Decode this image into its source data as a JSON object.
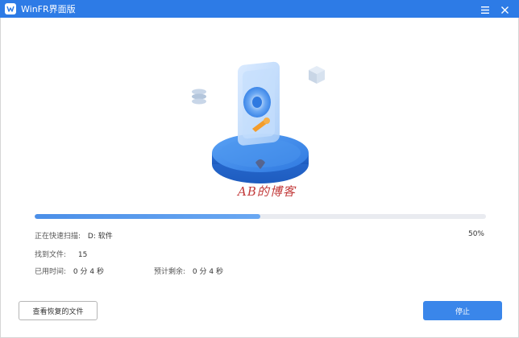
{
  "window": {
    "title": "WinFR界面版"
  },
  "scan": {
    "status_label": "正在快速扫描:",
    "status_value": "D: 软件",
    "progress_percent": 50,
    "progress_text": "50%",
    "found_label": "找到文件:",
    "found_value": "15",
    "elapsed_label": "已用时间:",
    "elapsed_value": "0 分 4 秒",
    "remaining_label": "预计剩余:",
    "remaining_value": "0 分 4 秒"
  },
  "watermark": {
    "text": "AB的博客"
  },
  "buttons": {
    "view_recovered": "查看恢复的文件",
    "stop": "停止"
  },
  "colors": {
    "accent": "#2d7be6",
    "progress": "#4b8fe8",
    "track": "#e9ebf0"
  },
  "icons": {
    "app": "winfr-logo-icon",
    "menu": "menu-icon",
    "close": "close-icon",
    "illustration": "hard-drive-scan-illustration"
  }
}
